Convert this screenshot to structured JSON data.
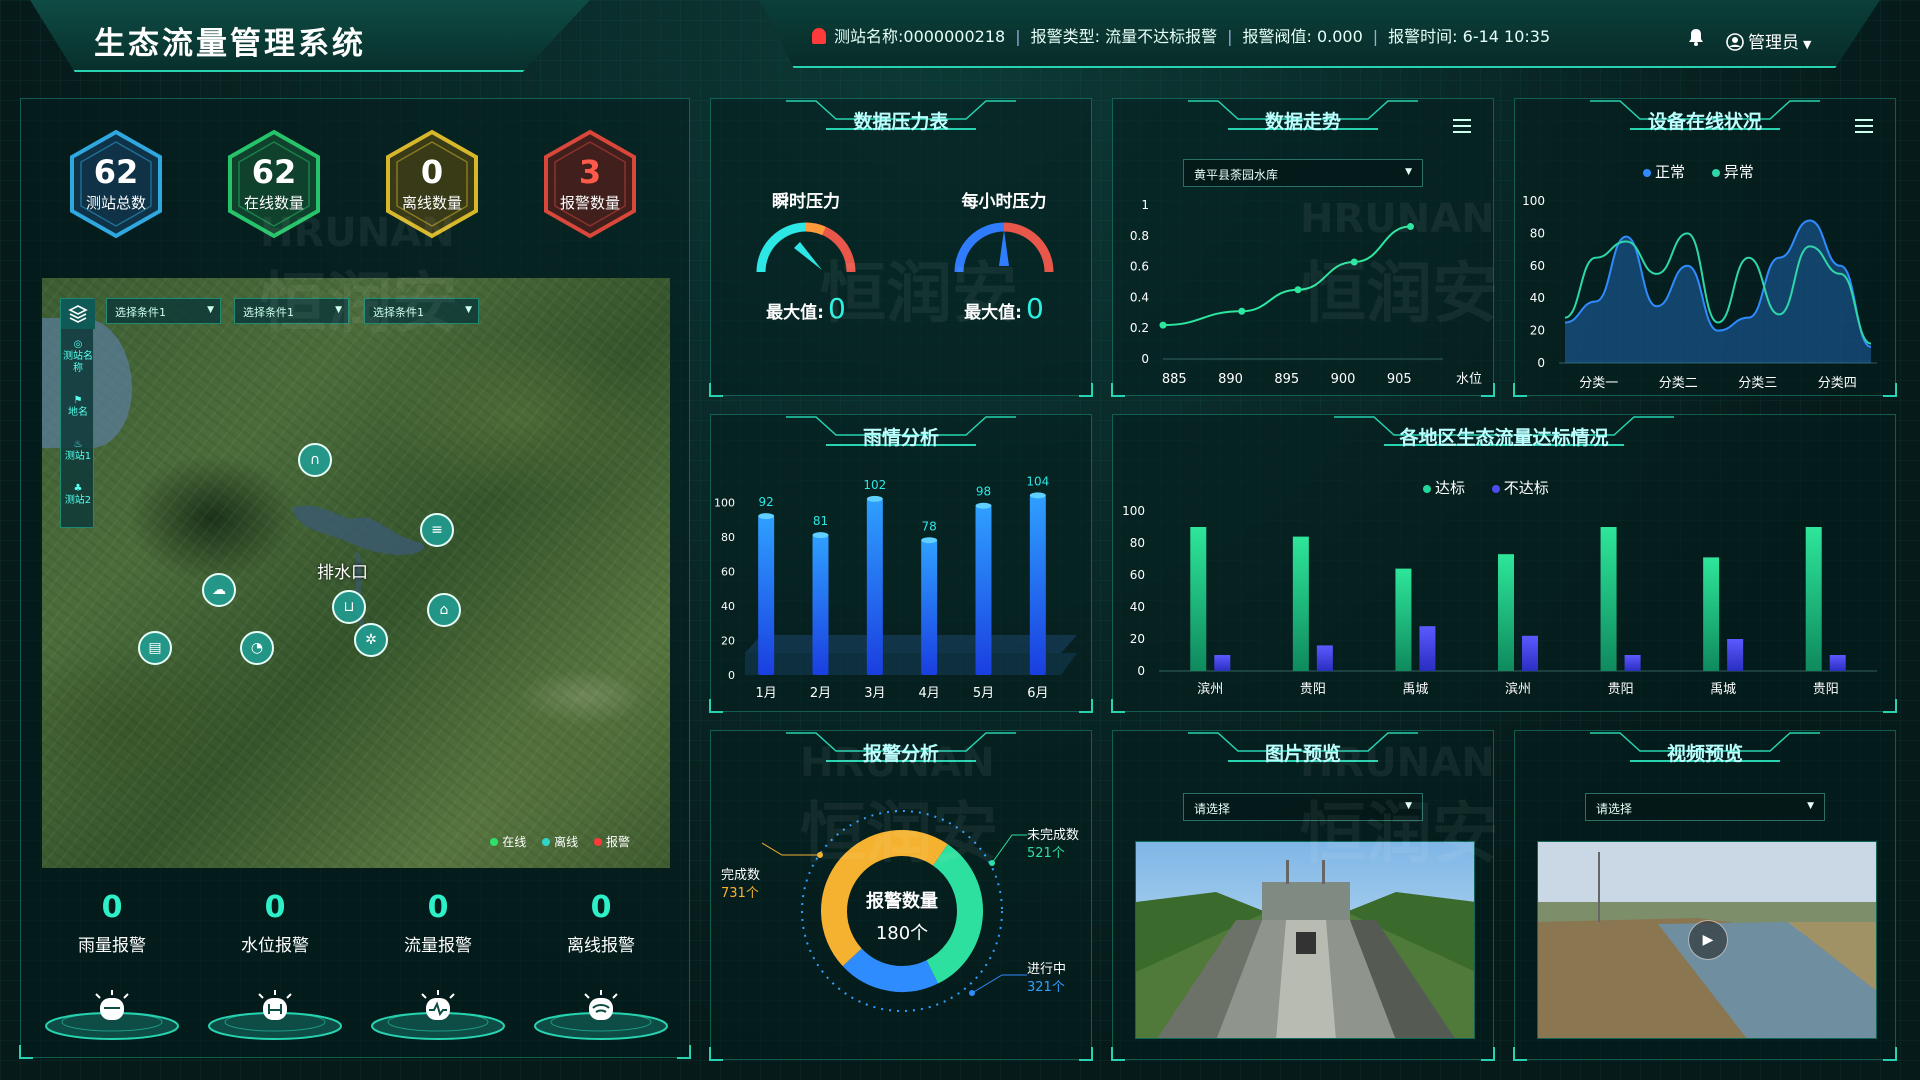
{
  "header": {
    "title": "生态流量管理系统",
    "alarm": {
      "station": "测站名称:0000000218",
      "type": "报警类型: 流量不达标报警",
      "threshold": "报警阀值: 0.000",
      "time": "报警时间: 6-14 10:35"
    },
    "user": "管理员",
    "icons": {
      "alarm": "alarm-light-icon",
      "bell": "bell-icon",
      "user": "user-icon"
    }
  },
  "stats": [
    {
      "value": "62",
      "label": "测站总数",
      "color": "#2fa8e0"
    },
    {
      "value": "62",
      "label": "在线数量",
      "color": "#25c46a"
    },
    {
      "value": "0",
      "label": "离线数量",
      "color": "#d8b72a"
    },
    {
      "value": "3",
      "label": "报警数量",
      "color": "#d9463a"
    }
  ],
  "map": {
    "selects": [
      "选择条件1",
      "选择条件1",
      "选择条件1"
    ],
    "tools": [
      "测站名称",
      "地名",
      "测站1",
      "测站2"
    ],
    "place_label": "排水口",
    "legend": [
      {
        "label": "在线",
        "color": "#2ee06a"
      },
      {
        "label": "离线",
        "color": "#2fd6c6"
      },
      {
        "label": "报警",
        "color": "#ff3a3a"
      }
    ]
  },
  "alerts": [
    {
      "value": "0",
      "label": "雨量报警",
      "icon": "rain-alarm-icon"
    },
    {
      "value": "0",
      "label": "水位报警",
      "icon": "water-level-alarm-icon"
    },
    {
      "value": "0",
      "label": "流量报警",
      "icon": "flow-alarm-icon"
    },
    {
      "value": "0",
      "label": "离线报警",
      "icon": "offline-alarm-icon"
    }
  ],
  "pressure": {
    "title": "数据压力表",
    "instant": {
      "label": "瞬时压力",
      "max_label": "最大值:",
      "max_value": "0"
    },
    "hourly": {
      "label": "每小时压力",
      "max_label": "最大值:",
      "max_value": "0"
    }
  },
  "trend": {
    "title": "数据走势",
    "select": "黄平县荼园水库"
  },
  "device": {
    "title": "设备在线状况",
    "legend": [
      {
        "label": "正常",
        "color": "#2f8cff"
      },
      {
        "label": "异常",
        "color": "#2fd6a8"
      }
    ]
  },
  "rain": {
    "title": "雨情分析"
  },
  "region": {
    "title": "各地区生态流量达标情况",
    "legend": [
      {
        "label": "达标",
        "color": "#25d69a"
      },
      {
        "label": "不达标",
        "color": "#4a4ef0"
      }
    ]
  },
  "alarm_analysis": {
    "title": "报警分析",
    "center_label": "报警数量",
    "center_value": "180个",
    "done": {
      "label": "完成数",
      "value": "731个"
    },
    "undone": {
      "label": "未完成数",
      "value": "521个"
    },
    "progress": {
      "label": "进行中",
      "value": "321个"
    }
  },
  "image_preview": {
    "title": "图片预览",
    "select": "请选择"
  },
  "video_preview": {
    "title": "视频预览",
    "select": "请选择"
  },
  "watermark": {
    "en": "HRUNAN",
    "zh": "恒润安"
  },
  "chart_data": [
    {
      "type": "line",
      "title": "数据走势",
      "xlabel": "水位",
      "x": [
        885,
        890,
        895,
        900,
        905
      ],
      "x_ticks": [
        "885",
        "890",
        "895",
        "900",
        "905"
      ],
      "y_ticks": [
        "0",
        "0.2",
        "0.4",
        "0.6",
        "0.8",
        "1"
      ],
      "ylim": [
        0,
        1
      ],
      "xlim": [
        884,
        908
      ],
      "series": [
        {
          "x": [
            884,
            891,
            896,
            901,
            906
          ],
          "values": [
            0.22,
            0.31,
            0.45,
            0.63,
            0.86
          ]
        }
      ]
    },
    {
      "type": "area",
      "title": "设备在线状况",
      "categories": [
        "分类一",
        "分类二",
        "分类三",
        "分类四"
      ],
      "y_ticks": [
        "0",
        "20",
        "40",
        "60",
        "80",
        "100"
      ],
      "ylim": [
        0,
        100
      ],
      "series": [
        {
          "name": "正常",
          "values": [
            25,
            38,
            78,
            35,
            60,
            20,
            28,
            65,
            88,
            60,
            10
          ]
        },
        {
          "name": "异常",
          "values": [
            28,
            65,
            75,
            55,
            80,
            25,
            65,
            30,
            72,
            55,
            12
          ]
        }
      ]
    },
    {
      "type": "bar",
      "title": "雨情分析",
      "categories": [
        "1月",
        "2月",
        "3月",
        "4月",
        "5月",
        "6月"
      ],
      "values": [
        92,
        81,
        102,
        78,
        98,
        104
      ],
      "y_ticks": [
        "0",
        "20",
        "40",
        "60",
        "80",
        "100"
      ],
      "ylim": [
        0,
        110
      ]
    },
    {
      "type": "bar",
      "title": "各地区生态流量达标情况",
      "categories": [
        "滨州",
        "贵阳",
        "禹城",
        "滨州",
        "贵阳",
        "禹城",
        "贵阳"
      ],
      "y_ticks": [
        "0",
        "20",
        "40",
        "60",
        "80",
        "100"
      ],
      "ylim": [
        0,
        100
      ],
      "series": [
        {
          "name": "达标",
          "values": [
            90,
            84,
            64,
            73,
            90,
            71,
            90
          ]
        },
        {
          "name": "不达标",
          "values": [
            10,
            16,
            28,
            22,
            10,
            20,
            10
          ]
        }
      ]
    },
    {
      "type": "pie",
      "title": "报警分析",
      "categories": [
        "完成数",
        "未完成数",
        "进行中"
      ],
      "values": [
        731,
        521,
        321
      ]
    }
  ]
}
